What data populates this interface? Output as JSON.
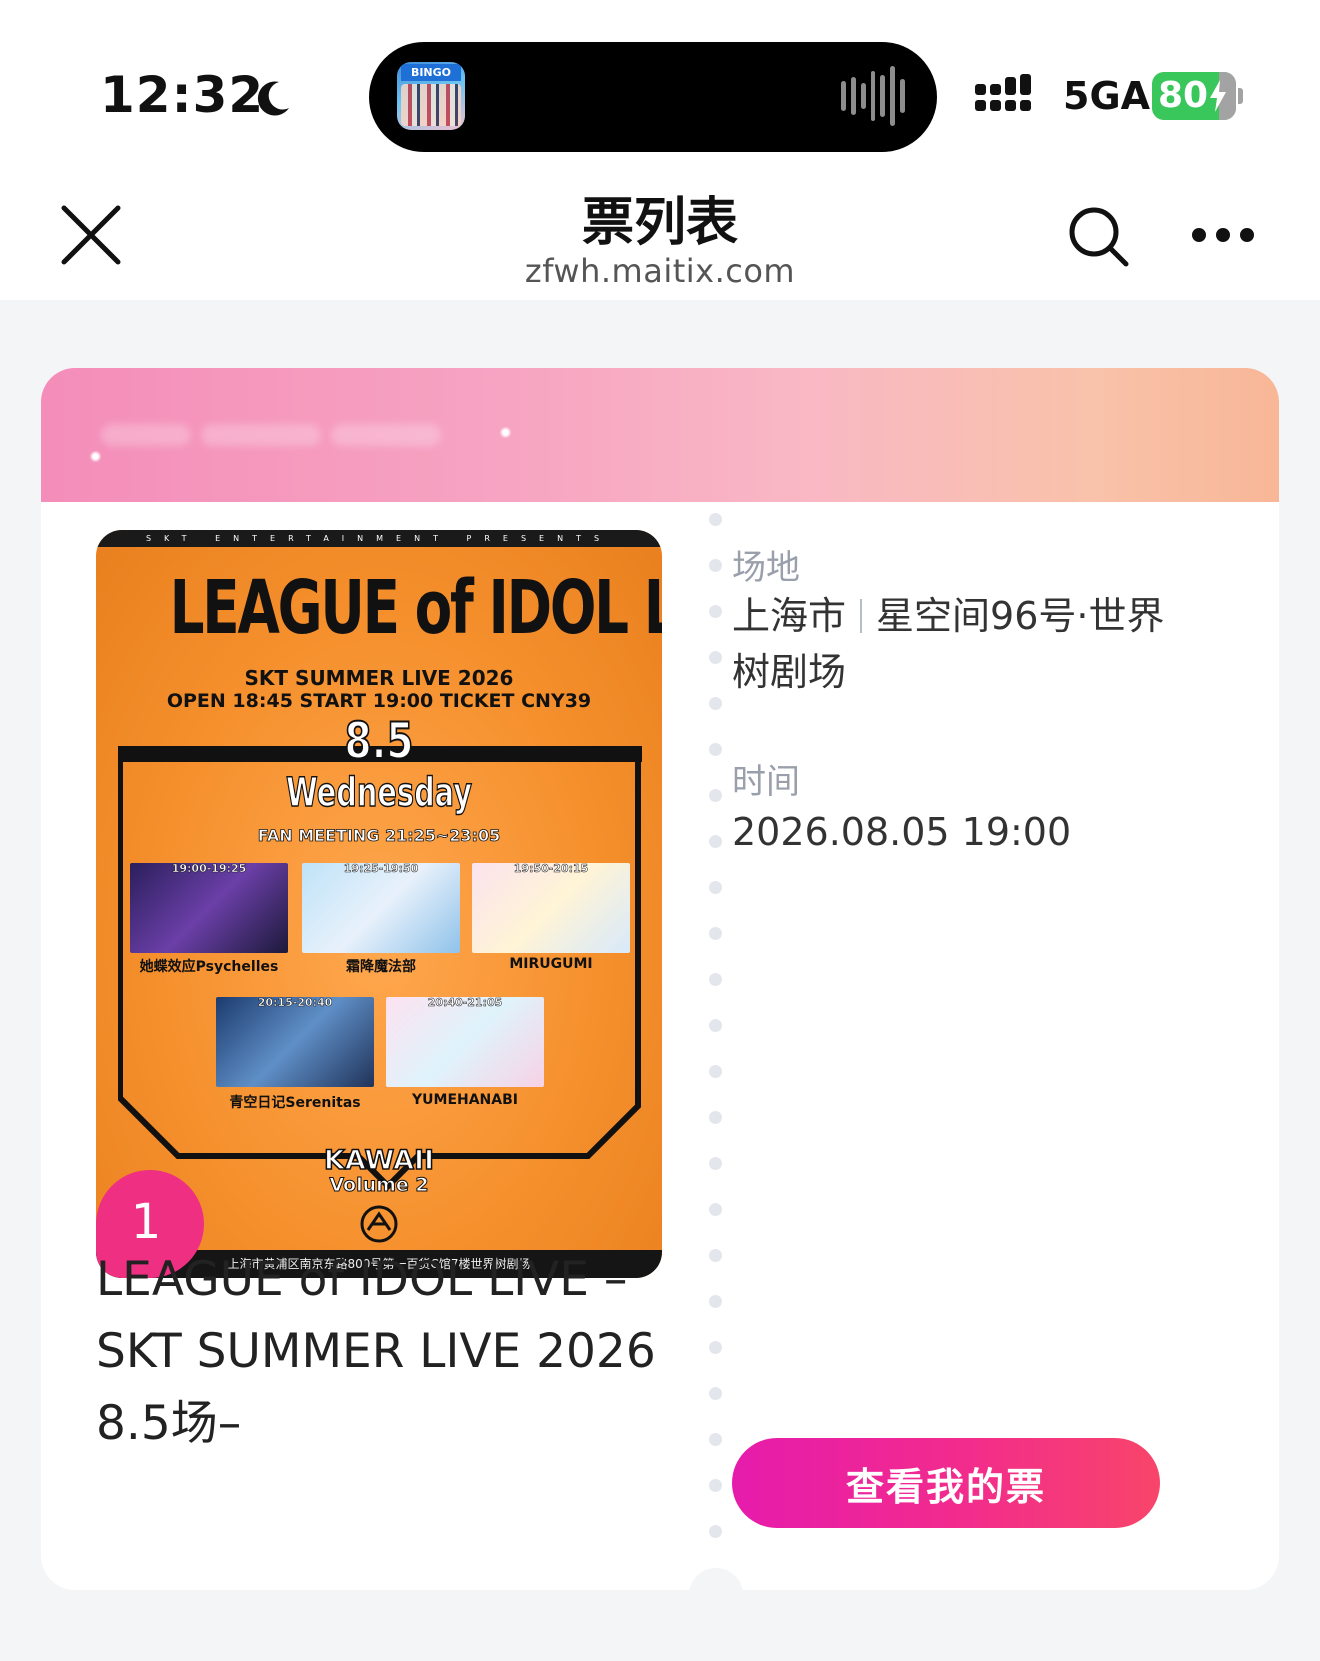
{
  "status_bar": {
    "time": "12:32",
    "network": "5GA",
    "battery": "80",
    "moon_icon": "moon-icon",
    "signal_icon": "signal-icon",
    "bolt_icon": "bolt-icon",
    "island_app_tag": "BINGO"
  },
  "nav": {
    "title": "票列表",
    "subtitle": "zfwh.maitix.com",
    "close_icon": "close-icon",
    "search_icon": "search-icon",
    "more_icon": "more-icon"
  },
  "ticket": {
    "rank": "1",
    "poster": {
      "top_strip": "SKT ENTERTAINMENT PRESENTS",
      "title": "LEAGUE of IDOL LIVE",
      "line1": "SKT SUMMER LIVE 2026",
      "line2": "OPEN 18:45 START 19:00 TICKET CNY39",
      "date": "8.5",
      "day": "Wednesday",
      "fan_meeting": "FAN MEETING 21:25~23:05",
      "acts": [
        {
          "time": "19:00-19:25",
          "name": "她蝶效应Psychelles"
        },
        {
          "time": "19:25-19:50",
          "name": "霜降魔法部"
        },
        {
          "time": "19:50-20:15",
          "name": "MIRUGUMI"
        },
        {
          "time": "20:15-20:40",
          "name": "青空日记Serenitas"
        },
        {
          "time": "20:40-21:05",
          "name": "YUMEHANABI"
        }
      ],
      "kawaii": "KAWAII",
      "volume": "Volume 2",
      "address": "上海市黄浦区南京东路800号第一百货C馆7楼世界树剧场"
    },
    "event_title": "LEAGUE of IDOL LIVE –SKT SUMMER LIVE 2026 8.5场–",
    "venue_label": "场地",
    "venue_city": "上海市",
    "venue_name": "星空间96号·世界树剧场",
    "time_label": "时间",
    "time_value": "2026.08.05 19:00",
    "view_button": "查看我的票"
  },
  "colors": {
    "accent_pink": "#ef2f82",
    "button_start": "#e61bac",
    "button_end": "#f8456a",
    "header_gradient_start": "#f48db9",
    "header_gradient_end": "#f8b797",
    "battery_green": "#39c65b"
  }
}
